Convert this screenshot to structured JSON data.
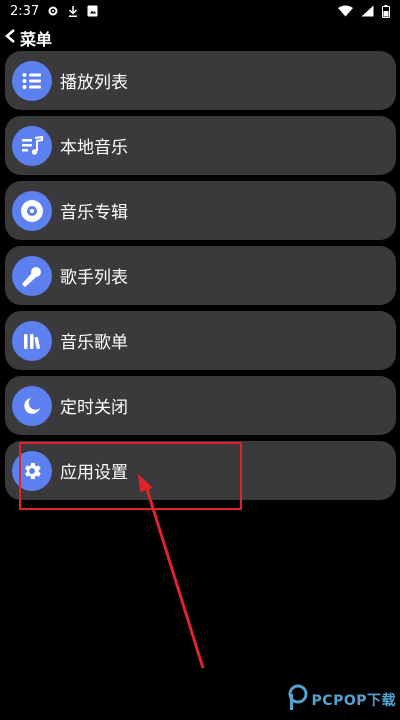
{
  "status_bar": {
    "time": "2:37",
    "left_icons": [
      "gear-icon",
      "download-icon",
      "notification-icon"
    ],
    "right_icons": [
      "wifi-icon",
      "signal-icon",
      "battery-icon"
    ]
  },
  "header": {
    "back_icon": "chevron-left-icon",
    "title": "菜单"
  },
  "menu": {
    "items": [
      {
        "label": "播放列表",
        "icon": "playlist-icon"
      },
      {
        "label": "本地音乐",
        "icon": "local-music-icon"
      },
      {
        "label": "音乐专辑",
        "icon": "album-icon"
      },
      {
        "label": "歌手列表",
        "icon": "microphone-icon"
      },
      {
        "label": "音乐歌单",
        "icon": "library-icon"
      },
      {
        "label": "定时关闭",
        "icon": "moon-icon"
      },
      {
        "label": "应用设置",
        "icon": "settings-icon"
      }
    ]
  },
  "annotation": {
    "highlight_color": "#e0242b",
    "highlighted_item": "应用设置"
  },
  "watermark": {
    "text": "PCPOP下载",
    "color": "#5fb3e6"
  },
  "colors": {
    "background": "#000000",
    "item_background": "#3a3a3c",
    "icon_background": "#5c80f0",
    "text": "#ffffff"
  }
}
